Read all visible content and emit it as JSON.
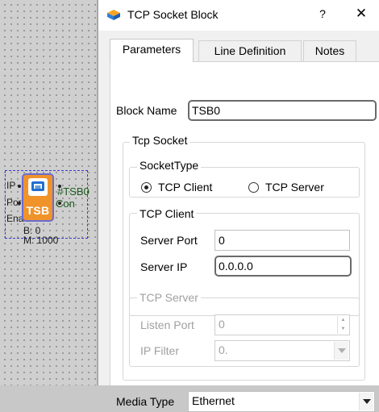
{
  "canvas": {
    "block_title": "TSB",
    "block_tag": "#TSB0",
    "port_labels_left": [
      "IP",
      "Por",
      "Ena"
    ],
    "port_label_right": "Con",
    "param_b": "B: 0",
    "param_m": "M: 1000"
  },
  "dialog": {
    "title": "TCP Socket Block",
    "help_label": "?",
    "close_label": "✕",
    "tabs": [
      {
        "label": "Parameters",
        "active": true
      },
      {
        "label": "Line Definition",
        "active": false
      },
      {
        "label": "Notes",
        "active": false
      }
    ],
    "block_name": {
      "label": "Block Name",
      "value": "TSB0"
    },
    "tcp_socket": {
      "legend": "Tcp Socket",
      "socket_type": {
        "legend": "SocketType",
        "options": [
          {
            "label": "TCP Client",
            "selected": true
          },
          {
            "label": "TCP Server",
            "selected": false
          }
        ]
      },
      "tcp_client": {
        "legend": "TCP Client",
        "server_port": {
          "label": "Server Port",
          "value": "0"
        },
        "server_ip": {
          "label": "Server IP",
          "value": "0.0.0.0"
        }
      },
      "tcp_server": {
        "legend": "TCP Server",
        "listen_port": {
          "label": "Listen Port",
          "value": "0"
        },
        "ip_filter": {
          "label": "IP Filter",
          "value": "0."
        }
      }
    },
    "media_type": {
      "label": "Media Type",
      "value": "Ethernet"
    }
  },
  "colors": {
    "block_fill": "#f0932a",
    "selection": "#3a3ad8",
    "tag_text": "#1c5a1c"
  }
}
